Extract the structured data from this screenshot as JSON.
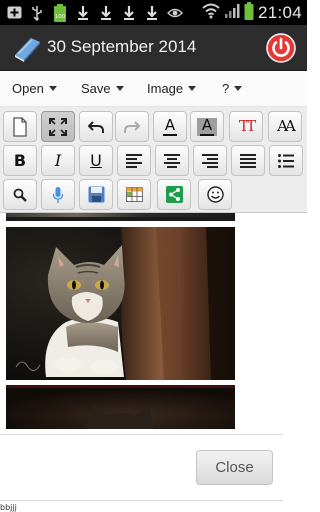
{
  "status_bar": {
    "time": "21:04",
    "battery_level_label": "100",
    "icons": [
      "add-icon",
      "usb-icon",
      "battery-full-icon",
      "download-icon",
      "download-icon",
      "download-icon",
      "download-icon",
      "eye-icon",
      "wifi-icon",
      "signal-icon",
      "battery-icon"
    ]
  },
  "action_bar": {
    "title": "30 September 2014",
    "app_icon": "book-icon",
    "power_icon": "power-icon",
    "background": "#2d2d2d",
    "accent": "#e53935"
  },
  "menu": {
    "items": [
      {
        "label": "Open"
      },
      {
        "label": "Save"
      },
      {
        "label": "Image"
      },
      {
        "label": "?"
      }
    ]
  },
  "toolbar": {
    "row1": [
      "new-document-icon",
      "fullscreen-icon",
      "undo-icon",
      "redo-icon",
      "font-color-icon",
      "highlight-color-icon",
      "text-size-icon",
      "font-icon"
    ],
    "row2": {
      "bold": "B",
      "italic": "I",
      "underline": "U",
      "align": [
        "align-left-icon",
        "align-center-icon",
        "align-right-icon",
        "align-justify-icon",
        "bullet-list-icon"
      ]
    },
    "row3": [
      "search-icon",
      "microphone-icon",
      "save-disk-icon",
      "insert-table-icon",
      "share-icon",
      "emoticon-icon"
    ],
    "font_color_letter": "A",
    "highlight_letter": "A",
    "text_size_label": "TT",
    "font_label": "AA",
    "bold_letter": "B",
    "italic_letter": "I",
    "underline_letter": "U"
  },
  "content": {
    "images": [
      "cat-photo-partial-top",
      "cat-photo",
      "cat-photo-partial-bottom"
    ]
  },
  "dialog": {
    "close_label": "Close"
  },
  "footer": {
    "text": "bbjjj"
  }
}
